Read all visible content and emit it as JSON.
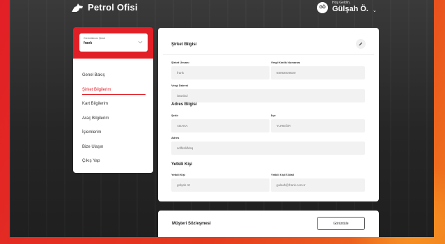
{
  "header": {
    "brand": "Petrol Ofisi",
    "user_initials": "GÖ",
    "greeting": "Hoş Geldin,",
    "user_name": "Gülşah Ö."
  },
  "company_select": {
    "label": "Görüntülenen Şirket",
    "value": "frank"
  },
  "menu": {
    "items": [
      {
        "label": "Genel Bakış"
      },
      {
        "label": "Şirket Bilgilerim"
      },
      {
        "label": "Kart Bilgilerim"
      },
      {
        "label": "Araç Bilgilerim"
      },
      {
        "label": "İşlemlerim"
      },
      {
        "label": "Bize Ulaşın"
      },
      {
        "label": "Çıkış Yap"
      }
    ],
    "active_index": 1
  },
  "company_info": {
    "title": "Şirket Bilgisi",
    "company_name_label": "Şirket Ünvanı",
    "company_name_value": "frank",
    "tax_id_label": "Vergi Kimlik Numarası",
    "tax_id_value": "93092039020",
    "tax_office_label": "Vergi Dairesi",
    "tax_office_value": "istanbul"
  },
  "address_info": {
    "title": "Adres Bilgisi",
    "city_label": "Şehir",
    "city_value": "ADANA",
    "district_label": "İlçe",
    "district_value": "YUREĞİR",
    "address_label": "Adres",
    "address_value": "sdlfkslkfdsq"
  },
  "contact_info": {
    "title": "Yetkili Kişi",
    "person_label": "Yetkili Kişi",
    "person_value": "gülşah öz",
    "email_label": "Yetkili Kişi E-Mail",
    "email_value": "gulsah@frank.com.tr"
  },
  "contract": {
    "title": "Müşteri Sözleşmesi",
    "view_label": "Görüntüle"
  },
  "colors": {
    "brand_red": "#e21f26",
    "field_bg": "#f2f2f2"
  }
}
